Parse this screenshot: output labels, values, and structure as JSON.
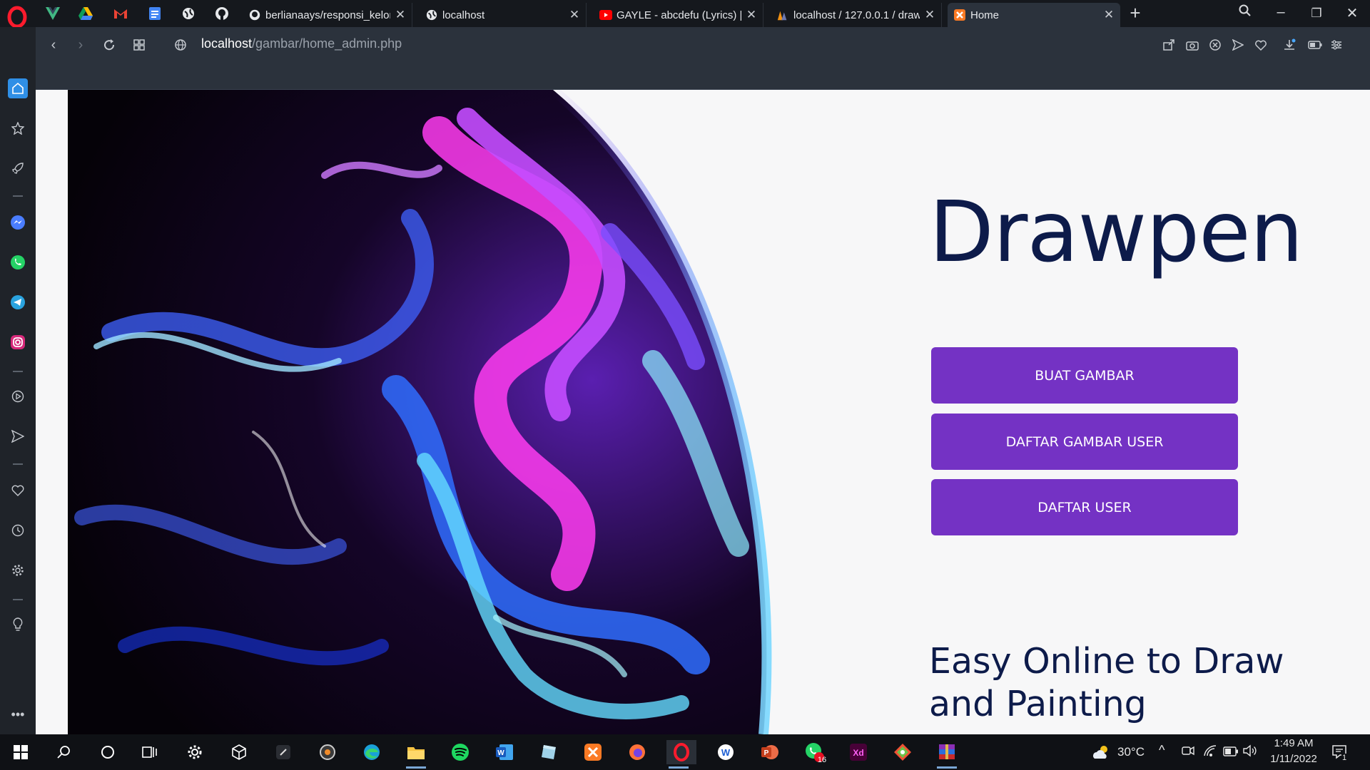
{
  "browser": {
    "tabs": [
      {
        "title": "berlianaays/responsi_kelon",
        "favicon": "github-icon"
      },
      {
        "title": "localhost",
        "favicon": "globe-icon"
      },
      {
        "title": "GAYLE - abcdefu (Lyrics) | T",
        "favicon": "youtube-icon"
      },
      {
        "title": "localhost / 127.0.0.1 / draw",
        "favicon": "phpmyadmin-icon"
      },
      {
        "title": "Home",
        "favicon": "xampp-icon"
      }
    ],
    "pinned": [
      "vue-icon",
      "google-drive-icon",
      "gmail-icon",
      "google-docs-icon",
      "globe-icon",
      "github-icon"
    ],
    "url_host": "localhost",
    "url_path": "/gambar/home_admin.php"
  },
  "page": {
    "brand": "Drawpen",
    "buttons": {
      "create": "BUAT GAMBAR",
      "user_drawings": "DAFTAR GAMBAR USER",
      "users": "DAFTAR USER"
    },
    "tagline": "Easy Online to Draw and Painting"
  },
  "taskbar": {
    "weather": "30°C",
    "time": "1:49 AM",
    "date": "1/11/2022",
    "notification_count": "1",
    "whatsapp_badge": "16"
  },
  "colors": {
    "accent": "#7432c4",
    "brand_text": "#0d1b4a",
    "page_bg": "#f7f7f8"
  }
}
